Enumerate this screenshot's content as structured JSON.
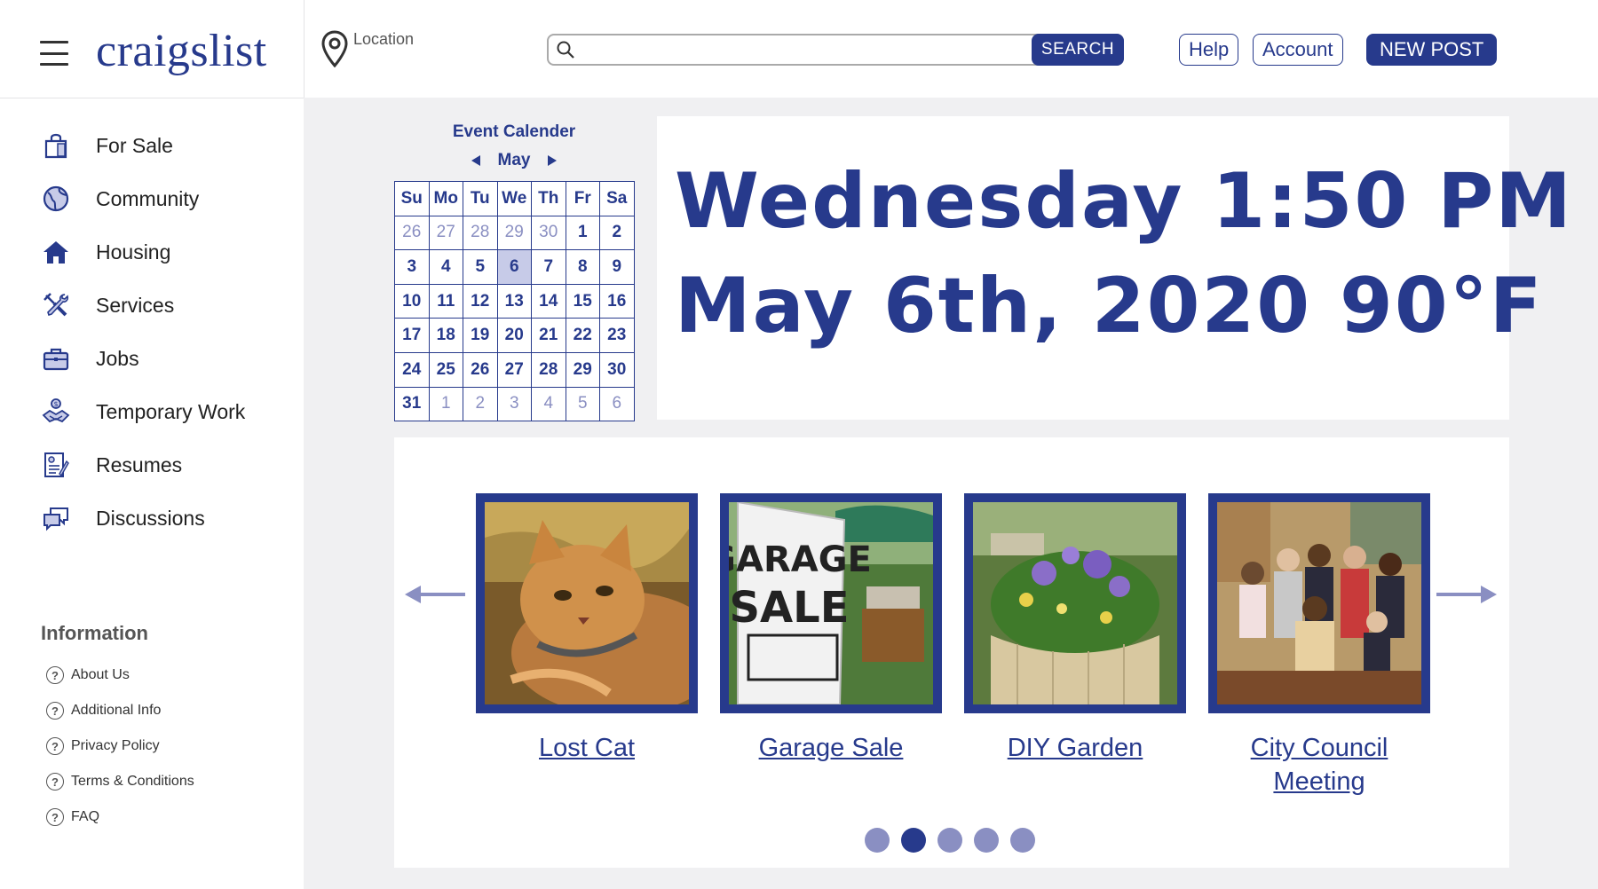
{
  "header": {
    "logo": "craigslist",
    "location_label": "Location",
    "search_placeholder": "",
    "search_button": "SEARCH",
    "help": "Help",
    "account": "Account",
    "new_post": "NEW POST"
  },
  "sidebar": {
    "items": [
      {
        "label": "For Sale",
        "icon": "shopping-bag-icon"
      },
      {
        "label": "Community",
        "icon": "globe-icon"
      },
      {
        "label": "Housing",
        "icon": "house-icon"
      },
      {
        "label": "Services",
        "icon": "tools-icon"
      },
      {
        "label": "Jobs",
        "icon": "briefcase-icon"
      },
      {
        "label": "Temporary Work",
        "icon": "handshake-icon"
      },
      {
        "label": "Resumes",
        "icon": "resume-icon"
      },
      {
        "label": "Discussions",
        "icon": "chat-icon"
      }
    ],
    "info_title": "Information",
    "info_items": [
      "About Us",
      "Additional Info",
      "Privacy Policy",
      "Terms & Conditions",
      "FAQ"
    ],
    "info_icon_glyph": "?"
  },
  "calendar": {
    "title": "Event Calender",
    "month": "May",
    "weekdays": [
      "Su",
      "Mo",
      "Tu",
      "We",
      "Th",
      "Fr",
      "Sa"
    ],
    "weeks": [
      [
        "26",
        "27",
        "28",
        "29",
        "30",
        "1",
        "2"
      ],
      [
        "3",
        "4",
        "5",
        "6",
        "7",
        "8",
        "9"
      ],
      [
        "10",
        "11",
        "12",
        "13",
        "14",
        "15",
        "16"
      ],
      [
        "17",
        "18",
        "19",
        "20",
        "21",
        "22",
        "23"
      ],
      [
        "24",
        "25",
        "26",
        "27",
        "28",
        "29",
        "30"
      ],
      [
        "31",
        "1",
        "2",
        "3",
        "4",
        "5",
        "6"
      ]
    ],
    "today": "6"
  },
  "datetime": {
    "line1": "Wednesday 1:50 PM",
    "line2": "May 6th, 2020 90°F"
  },
  "carousel": {
    "cards": [
      {
        "caption": "Lost Cat",
        "image": "cat-photo"
      },
      {
        "caption": "Garage Sale",
        "image": "garage-sale-sign-photo",
        "sign_text": [
          "GARAGE",
          "SALE"
        ]
      },
      {
        "caption": "DIY Garden",
        "image": "garden-photo"
      },
      {
        "caption": "City Council Meeting",
        "image": "council-group-photo"
      }
    ],
    "dot_count": 5,
    "active_dot": 2
  },
  "colors": {
    "brand": "#273a8c",
    "muted": "#8a8fc2",
    "today_highlight": "#c7cbe8",
    "background": "#f0f0f2"
  }
}
